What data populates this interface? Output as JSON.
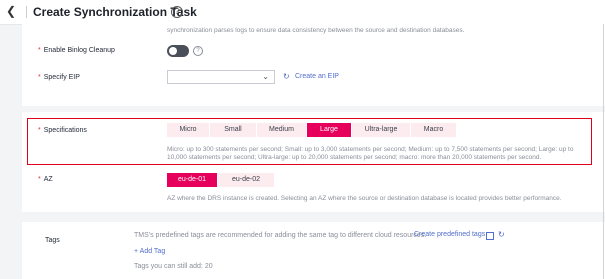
{
  "header": {
    "back_icon": "back-arrow-icon",
    "title": "Create Synchronization Task"
  },
  "top_hint": "synchronization parses logs to ensure data consistency between the source and destination databases.",
  "binlog": {
    "label": "Enable Binlog Cleanup",
    "enabled": false
  },
  "eip": {
    "label": "Specify EIP",
    "value": "",
    "create_link": "Create an EIP"
  },
  "specifications": {
    "label": "Specifications",
    "options": [
      "Micro",
      "Small",
      "Medium",
      "Large",
      "Ultra-large",
      "Macro"
    ],
    "selected": "Large",
    "hint_line1": "Micro: up to 300 statements per second; Small: up to 3,000 statements per second; Medium: up to 7,500 statements per second; Large: up to",
    "hint_line2": "10,000 statements per second; Ultra-large: up to 20,000 statements per second; macro: more than 20,000 statements per second."
  },
  "az": {
    "label": "AZ",
    "options": [
      "eu-de-01",
      "eu-de-02"
    ],
    "selected": "eu-de-01",
    "hint": "AZ where the DRS instance is created. Selecting an AZ where the source or destination database is located provides better performance."
  },
  "tags": {
    "label": "Tags",
    "hint": "TMS's predefined tags are recommended for adding the same tag to different cloud resources.",
    "predefined_link": "Create predefined tags",
    "add_tag": "+ Add Tag",
    "remaining": "Tags you can still add: 20"
  },
  "colors": {
    "accent": "#e6005c",
    "link": "#526ecc",
    "highlight_border": "#e0001b"
  }
}
